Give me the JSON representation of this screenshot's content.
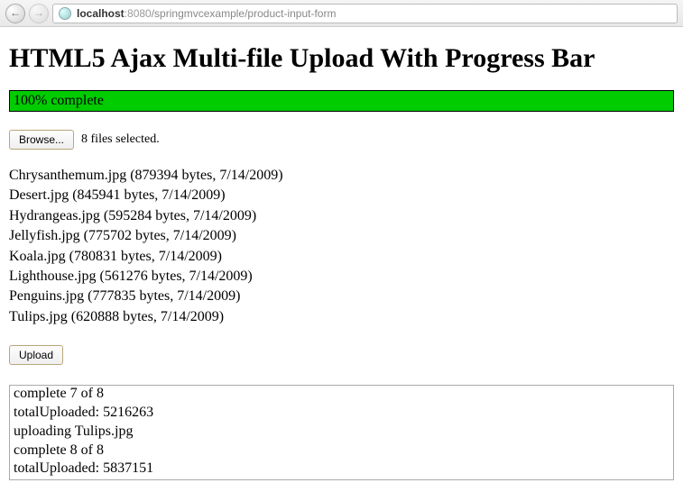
{
  "browser": {
    "url_host": "localhost",
    "url_port": ":8080",
    "url_path": "/springmvcexample/product-input-form"
  },
  "page": {
    "title": "HTML5 Ajax Multi-file Upload With Progress Bar"
  },
  "progress": {
    "text": "100% complete"
  },
  "file_input": {
    "browse_label": "Browse...",
    "status": "8 files selected."
  },
  "files": [
    {
      "line": "Chrysanthemum.jpg (879394 bytes, 7/14/2009)"
    },
    {
      "line": "Desert.jpg (845941 bytes, 7/14/2009)"
    },
    {
      "line": "Hydrangeas.jpg (595284 bytes, 7/14/2009)"
    },
    {
      "line": "Jellyfish.jpg (775702 bytes, 7/14/2009)"
    },
    {
      "line": "Koala.jpg (780831 bytes, 7/14/2009)"
    },
    {
      "line": "Lighthouse.jpg (561276 bytes, 7/14/2009)"
    },
    {
      "line": "Penguins.jpg (777835 bytes, 7/14/2009)"
    },
    {
      "line": "Tulips.jpg (620888 bytes, 7/14/2009)"
    }
  ],
  "upload": {
    "label": "Upload"
  },
  "log": {
    "text": "complete 7 of 8\ntotalUploaded: 5216263\nuploading Tulips.jpg\ncomplete 8 of 8\ntotalUploaded: 5837151"
  }
}
